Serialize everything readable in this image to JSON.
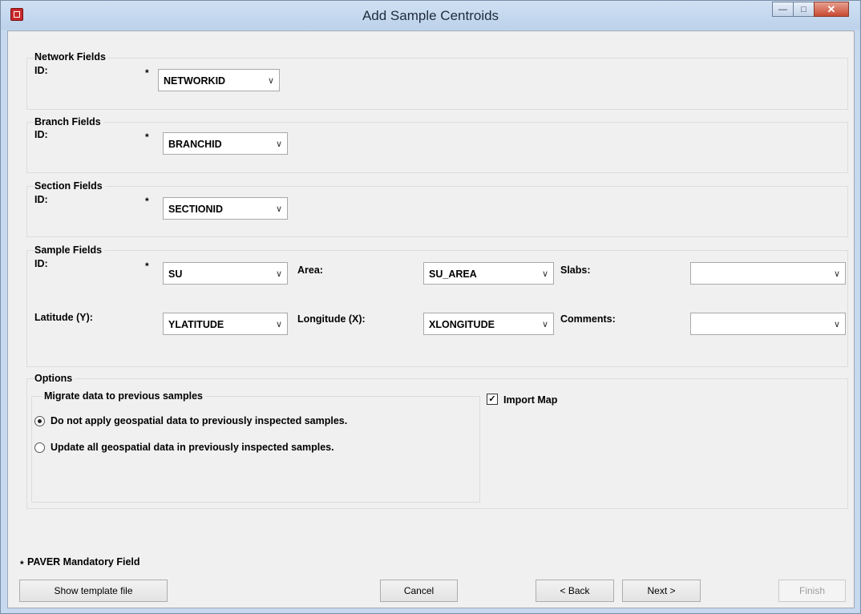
{
  "window": {
    "title": "Add Sample Centroids"
  },
  "groups": {
    "network": {
      "label": "Network Fields",
      "id_label": "ID:",
      "id_value": "NETWORKID"
    },
    "branch": {
      "label": "Branch Fields",
      "id_label": "ID:",
      "id_value": "BRANCHID"
    },
    "section": {
      "label": "Section Fields",
      "id_label": "ID:",
      "id_value": "SECTIONID"
    },
    "sample": {
      "label": "Sample Fields",
      "id_label": "ID:",
      "id_value": "SU",
      "area_label": "Area:",
      "area_value": "SU_AREA",
      "slabs_label": "Slabs:",
      "slabs_value": "",
      "lat_label": "Latitude (Y):",
      "lat_value": "YLATITUDE",
      "lon_label": "Longitude (X):",
      "lon_value": "XLONGITUDE",
      "comments_label": "Comments:",
      "comments_value": ""
    }
  },
  "options": {
    "label": "Options",
    "migrate_label": "Migrate data to previous samples",
    "radio1": "Do not apply geospatial data to previously inspected samples.",
    "radio2": "Update all geospatial data in previously inspected samples.",
    "selected_radio": 1,
    "import_map_label": "Import Map",
    "import_map_checked": true
  },
  "mandatory_note": "PAVER Mandatory Field",
  "mandatory_marker": "*",
  "buttons": {
    "template": "Show template file",
    "cancel": "Cancel",
    "back": "< Back",
    "next": "Next >",
    "finish": "Finish"
  }
}
